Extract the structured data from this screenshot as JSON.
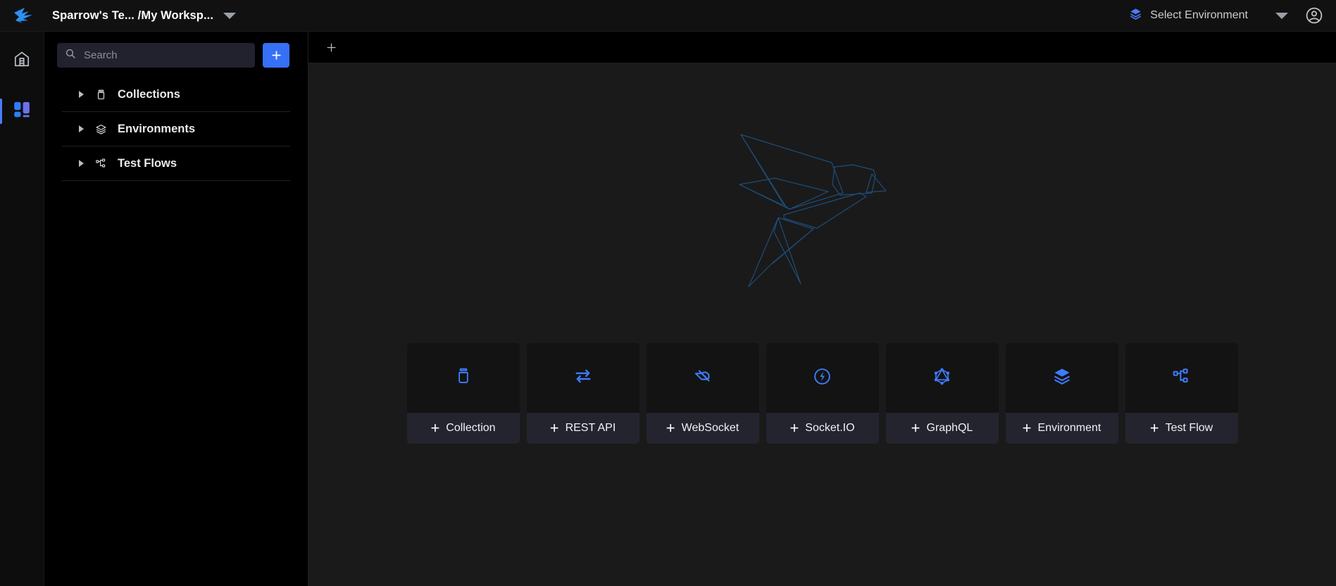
{
  "app": {
    "name": "Sparrow",
    "accent": "#3670f7",
    "bg": "#1a1a1a",
    "sidebar_bg": "#000000",
    "card_footer_bg": "#24242f"
  },
  "topbar": {
    "logo_icon": "sparrow-bird-logo-icon",
    "workspace_title": "Sparrow's Te... /My Worksp...",
    "workspace_chevron_icon": "chevron-down-icon",
    "environment": {
      "icon": "layers-icon",
      "label": "Select Environment",
      "chevron_icon": "chevron-down-icon"
    },
    "account_icon": "account-circle-icon"
  },
  "rail": {
    "items": [
      {
        "name": "home",
        "icon": "home-icon",
        "active": false
      },
      {
        "name": "workspace",
        "icon": "grid-dashboard-icon",
        "active": true
      }
    ]
  },
  "sidebar": {
    "search": {
      "icon": "search-icon",
      "placeholder": "Search",
      "value": ""
    },
    "add_button": {
      "icon": "plus-icon",
      "label": "+"
    },
    "nav": [
      {
        "label": "Collections",
        "icon": "collection-jar-icon",
        "caret": "caret-right-icon"
      },
      {
        "label": "Environments",
        "icon": "layers-icon",
        "caret": "caret-right-icon"
      },
      {
        "label": "Test Flows",
        "icon": "flow-nodes-icon",
        "caret": "caret-right-icon"
      }
    ]
  },
  "tabbar": {
    "new_tab_icon": "plus-icon",
    "tabs": []
  },
  "canvas": {
    "illustration": "sparrow-bird-outline-illustration",
    "cards": [
      {
        "label": "Collection",
        "icon": "collection-jar-icon",
        "plus": "+"
      },
      {
        "label": "REST API",
        "icon": "rest-api-arrows-icon",
        "plus": "+"
      },
      {
        "label": "WebSocket",
        "icon": "websocket-icon",
        "plus": "+"
      },
      {
        "label": "Socket.IO",
        "icon": "socketio-bolt-icon",
        "plus": "+"
      },
      {
        "label": "GraphQL",
        "icon": "graphql-icon",
        "plus": "+"
      },
      {
        "label": "Environment",
        "icon": "layers-icon",
        "plus": "+"
      },
      {
        "label": "Test Flow",
        "icon": "flow-nodes-icon",
        "plus": "+"
      }
    ]
  }
}
